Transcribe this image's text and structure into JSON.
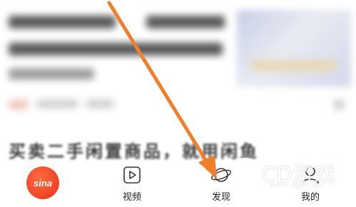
{
  "feed": {
    "headline": "买卖二手闲置商品，就用闲鱼"
  },
  "tabbar": {
    "tabs": [
      {
        "label": "",
        "icon": "sina-logo-icon"
      },
      {
        "label": "视频",
        "icon": "play-video-icon"
      },
      {
        "label": "发现",
        "icon": "planet-icon"
      },
      {
        "label": "我的",
        "icon": "person-icon"
      }
    ],
    "logo_text": "sina"
  },
  "watermark": {
    "text": "CD游戏",
    "sub": "www.cdgam.com"
  },
  "colors": {
    "arrow": "#f07f2a",
    "sina_red": "#e8321a",
    "text": "#222222"
  }
}
